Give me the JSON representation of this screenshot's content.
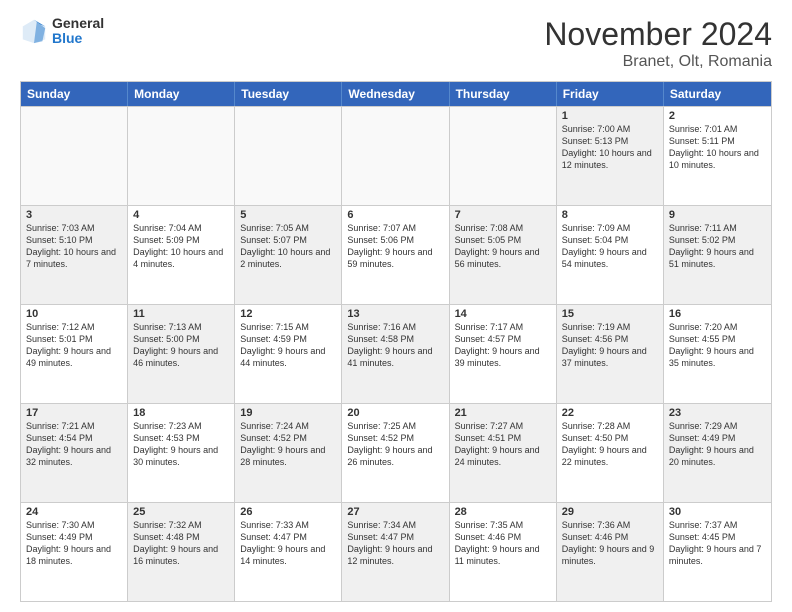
{
  "logo": {
    "general": "General",
    "blue": "Blue"
  },
  "title": {
    "month": "November 2024",
    "location": "Branet, Olt, Romania"
  },
  "calendar": {
    "headers": [
      "Sunday",
      "Monday",
      "Tuesday",
      "Wednesday",
      "Thursday",
      "Friday",
      "Saturday"
    ],
    "rows": [
      [
        {
          "day": "",
          "info": "",
          "empty": true
        },
        {
          "day": "",
          "info": "",
          "empty": true
        },
        {
          "day": "",
          "info": "",
          "empty": true
        },
        {
          "day": "",
          "info": "",
          "empty": true
        },
        {
          "day": "",
          "info": "",
          "empty": true
        },
        {
          "day": "1",
          "info": "Sunrise: 7:00 AM\nSunset: 5:13 PM\nDaylight: 10 hours and 12 minutes.",
          "shaded": true
        },
        {
          "day": "2",
          "info": "Sunrise: 7:01 AM\nSunset: 5:11 PM\nDaylight: 10 hours and 10 minutes.",
          "shaded": false
        }
      ],
      [
        {
          "day": "3",
          "info": "Sunrise: 7:03 AM\nSunset: 5:10 PM\nDaylight: 10 hours and 7 minutes.",
          "shaded": true
        },
        {
          "day": "4",
          "info": "Sunrise: 7:04 AM\nSunset: 5:09 PM\nDaylight: 10 hours and 4 minutes.",
          "shaded": false
        },
        {
          "day": "5",
          "info": "Sunrise: 7:05 AM\nSunset: 5:07 PM\nDaylight: 10 hours and 2 minutes.",
          "shaded": true
        },
        {
          "day": "6",
          "info": "Sunrise: 7:07 AM\nSunset: 5:06 PM\nDaylight: 9 hours and 59 minutes.",
          "shaded": false
        },
        {
          "day": "7",
          "info": "Sunrise: 7:08 AM\nSunset: 5:05 PM\nDaylight: 9 hours and 56 minutes.",
          "shaded": true
        },
        {
          "day": "8",
          "info": "Sunrise: 7:09 AM\nSunset: 5:04 PM\nDaylight: 9 hours and 54 minutes.",
          "shaded": false
        },
        {
          "day": "9",
          "info": "Sunrise: 7:11 AM\nSunset: 5:02 PM\nDaylight: 9 hours and 51 minutes.",
          "shaded": true
        }
      ],
      [
        {
          "day": "10",
          "info": "Sunrise: 7:12 AM\nSunset: 5:01 PM\nDaylight: 9 hours and 49 minutes.",
          "shaded": false
        },
        {
          "day": "11",
          "info": "Sunrise: 7:13 AM\nSunset: 5:00 PM\nDaylight: 9 hours and 46 minutes.",
          "shaded": true
        },
        {
          "day": "12",
          "info": "Sunrise: 7:15 AM\nSunset: 4:59 PM\nDaylight: 9 hours and 44 minutes.",
          "shaded": false
        },
        {
          "day": "13",
          "info": "Sunrise: 7:16 AM\nSunset: 4:58 PM\nDaylight: 9 hours and 41 minutes.",
          "shaded": true
        },
        {
          "day": "14",
          "info": "Sunrise: 7:17 AM\nSunset: 4:57 PM\nDaylight: 9 hours and 39 minutes.",
          "shaded": false
        },
        {
          "day": "15",
          "info": "Sunrise: 7:19 AM\nSunset: 4:56 PM\nDaylight: 9 hours and 37 minutes.",
          "shaded": true
        },
        {
          "day": "16",
          "info": "Sunrise: 7:20 AM\nSunset: 4:55 PM\nDaylight: 9 hours and 35 minutes.",
          "shaded": false
        }
      ],
      [
        {
          "day": "17",
          "info": "Sunrise: 7:21 AM\nSunset: 4:54 PM\nDaylight: 9 hours and 32 minutes.",
          "shaded": true
        },
        {
          "day": "18",
          "info": "Sunrise: 7:23 AM\nSunset: 4:53 PM\nDaylight: 9 hours and 30 minutes.",
          "shaded": false
        },
        {
          "day": "19",
          "info": "Sunrise: 7:24 AM\nSunset: 4:52 PM\nDaylight: 9 hours and 28 minutes.",
          "shaded": true
        },
        {
          "day": "20",
          "info": "Sunrise: 7:25 AM\nSunset: 4:52 PM\nDaylight: 9 hours and 26 minutes.",
          "shaded": false
        },
        {
          "day": "21",
          "info": "Sunrise: 7:27 AM\nSunset: 4:51 PM\nDaylight: 9 hours and 24 minutes.",
          "shaded": true
        },
        {
          "day": "22",
          "info": "Sunrise: 7:28 AM\nSunset: 4:50 PM\nDaylight: 9 hours and 22 minutes.",
          "shaded": false
        },
        {
          "day": "23",
          "info": "Sunrise: 7:29 AM\nSunset: 4:49 PM\nDaylight: 9 hours and 20 minutes.",
          "shaded": true
        }
      ],
      [
        {
          "day": "24",
          "info": "Sunrise: 7:30 AM\nSunset: 4:49 PM\nDaylight: 9 hours and 18 minutes.",
          "shaded": false
        },
        {
          "day": "25",
          "info": "Sunrise: 7:32 AM\nSunset: 4:48 PM\nDaylight: 9 hours and 16 minutes.",
          "shaded": true
        },
        {
          "day": "26",
          "info": "Sunrise: 7:33 AM\nSunset: 4:47 PM\nDaylight: 9 hours and 14 minutes.",
          "shaded": false
        },
        {
          "day": "27",
          "info": "Sunrise: 7:34 AM\nSunset: 4:47 PM\nDaylight: 9 hours and 12 minutes.",
          "shaded": true
        },
        {
          "day": "28",
          "info": "Sunrise: 7:35 AM\nSunset: 4:46 PM\nDaylight: 9 hours and 11 minutes.",
          "shaded": false
        },
        {
          "day": "29",
          "info": "Sunrise: 7:36 AM\nSunset: 4:46 PM\nDaylight: 9 hours and 9 minutes.",
          "shaded": true
        },
        {
          "day": "30",
          "info": "Sunrise: 7:37 AM\nSunset: 4:45 PM\nDaylight: 9 hours and 7 minutes.",
          "shaded": false
        }
      ]
    ]
  }
}
